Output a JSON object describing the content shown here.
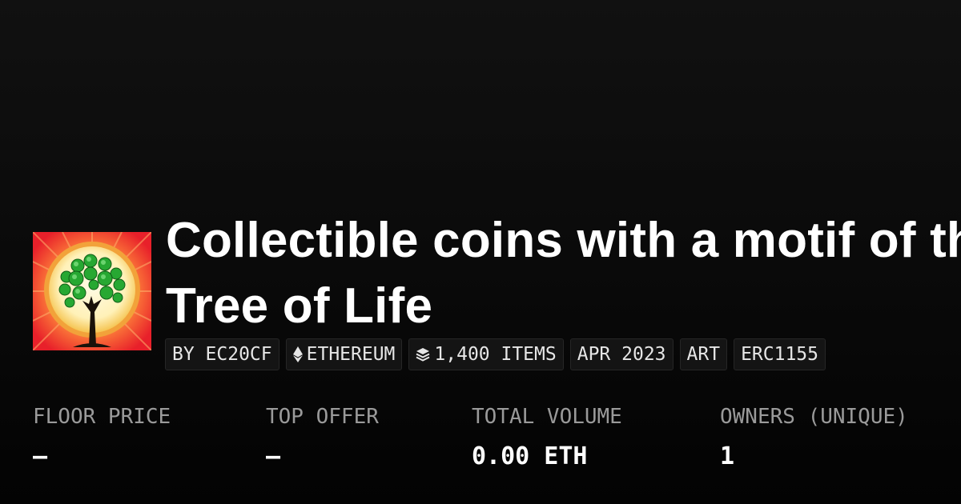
{
  "collection": {
    "title_line1": "Collectible coins with a motif of the",
    "title_line2": "Tree of Life",
    "image_icon": "tree-of-life-coin-image"
  },
  "tags": {
    "creator": "BY EC20CF",
    "chain": "ETHEREUM",
    "chain_icon": "ethereum-icon",
    "items": "1,400 ITEMS",
    "items_icon": "layers-icon",
    "date": "APR 2023",
    "category": "ART",
    "standard": "ERC1155"
  },
  "stats": {
    "floor_price": {
      "label": "FLOOR PRICE",
      "value": "–"
    },
    "top_offer": {
      "label": "TOP OFFER",
      "value": "–"
    },
    "total_volume": {
      "label": "TOTAL VOLUME",
      "value": "0.00 ETH"
    },
    "owners": {
      "label": "OWNERS (UNIQUE)",
      "value": "1"
    }
  },
  "colors": {
    "background": "#0a0a0a",
    "tag_background": "#141414",
    "label_gray": "#9a9a9a",
    "text": "#ffffff"
  }
}
